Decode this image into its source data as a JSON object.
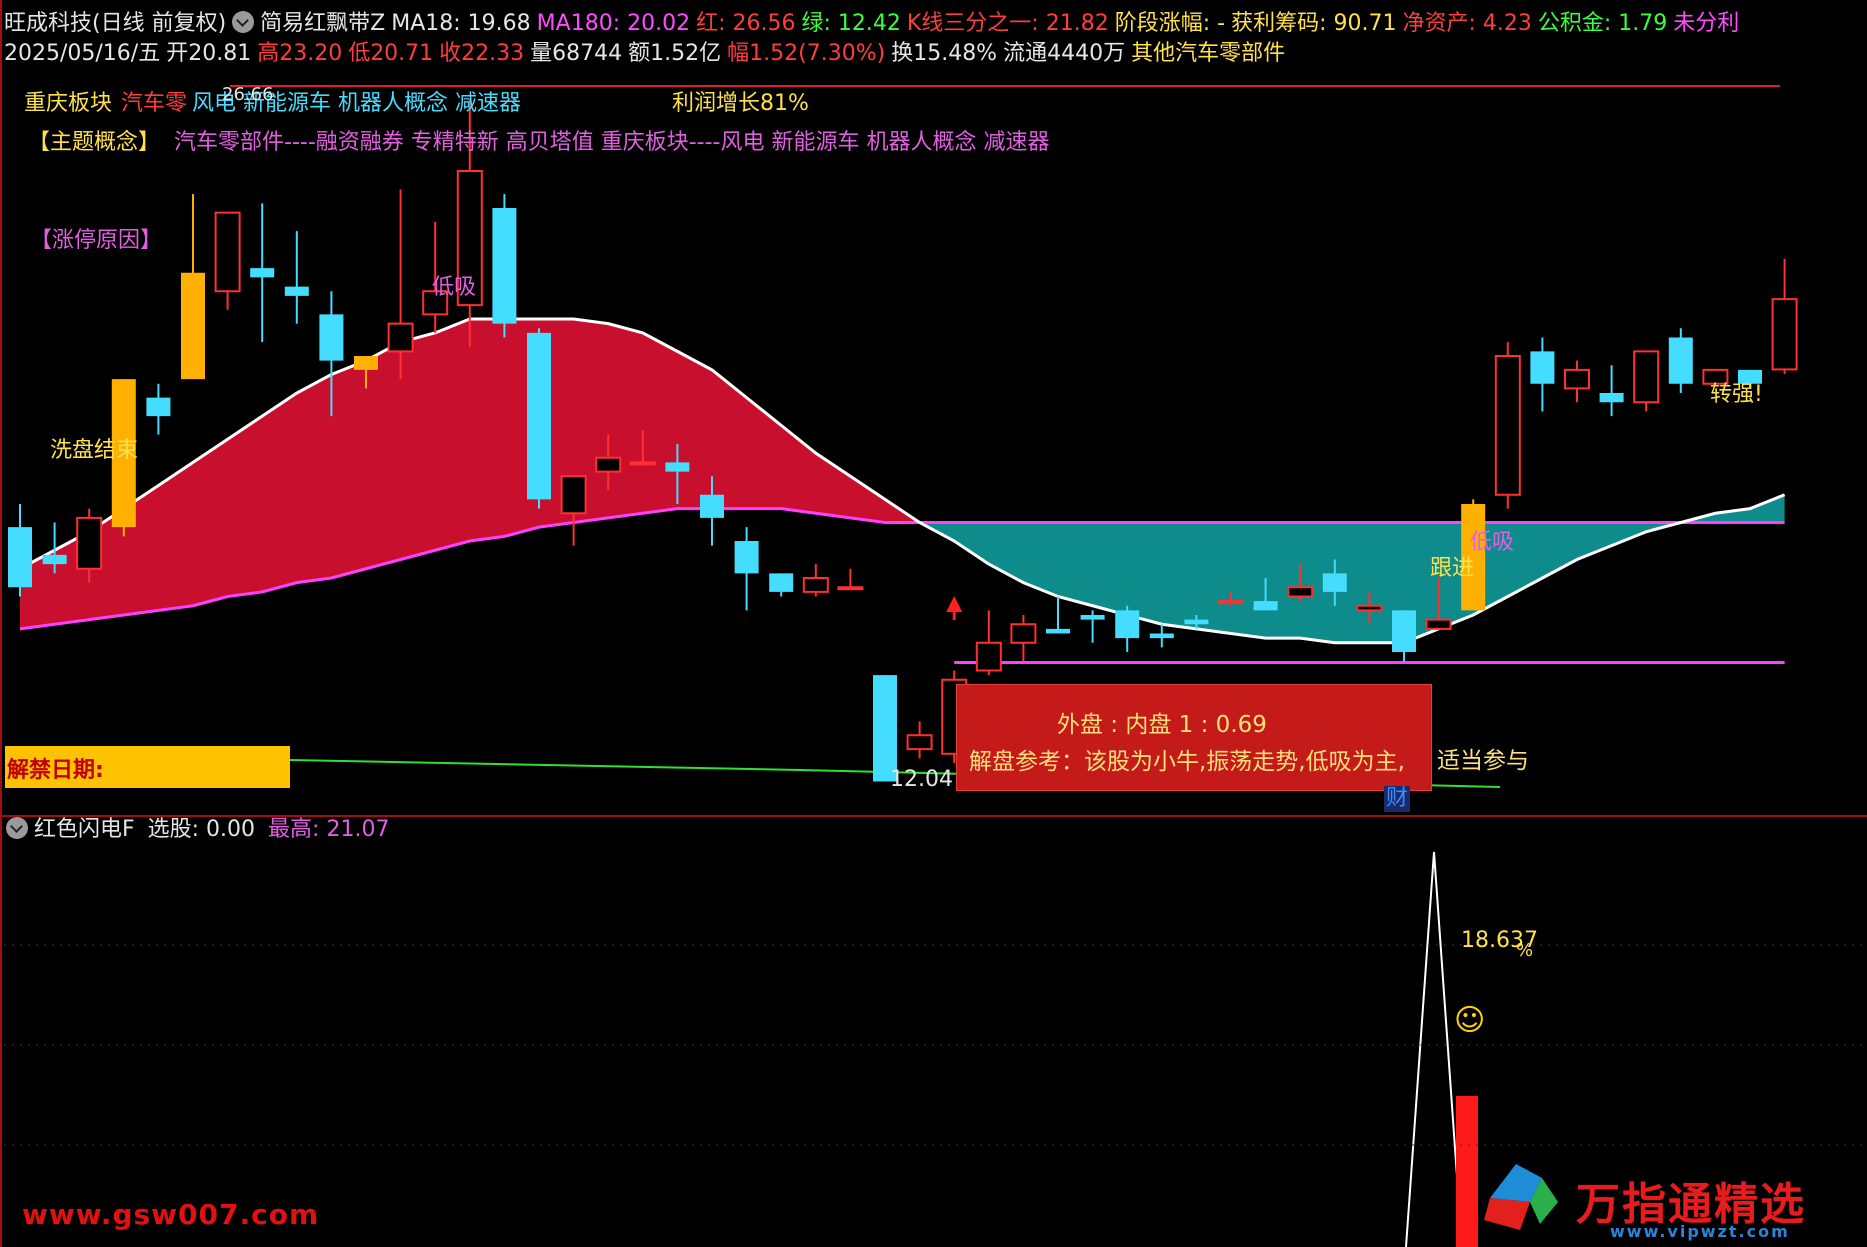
{
  "header": {
    "line1": [
      {
        "text": "旺成科技(日线 前复权)",
        "color": "#e6e6e6"
      },
      {
        "text": "",
        "color": "#9a9a9a",
        "icon": "settings-circle-icon"
      },
      {
        "text": "简易红飘带Z",
        "color": "#e6e6e6"
      },
      {
        "text": "MA18: 19.68",
        "color": "#e6e6e6"
      },
      {
        "text": "MA180: 20.02",
        "color": "#ff4bff"
      },
      {
        "text": "红: 26.56",
        "color": "#ff3d3d"
      },
      {
        "text": "绿: 12.42",
        "color": "#3cff3c"
      },
      {
        "text": "K线三分之一: 21.82",
        "color": "#ff3d3d"
      },
      {
        "text": "阶段涨幅: -",
        "color": "#ffe14a"
      },
      {
        "text": "获利筹码: 90.71",
        "color": "#ffe14a"
      },
      {
        "text": "净资产: 4.23",
        "color": "#ff3d3d"
      },
      {
        "text": "公积金: 1.79",
        "color": "#3cff3c"
      },
      {
        "text": "未分利",
        "color": "#ff4bff"
      }
    ],
    "line2": [
      {
        "text": "2025/05/16/五",
        "color": "#e6e6e6"
      },
      {
        "text": "开20.81",
        "color": "#e6e6e6"
      },
      {
        "text": "高23.20",
        "color": "#ff3d3d"
      },
      {
        "text": "低20.71",
        "color": "#ff3d3d"
      },
      {
        "text": "收22.33",
        "color": "#ff3d3d"
      },
      {
        "text": "量68744",
        "color": "#e6e6e6"
      },
      {
        "text": "额1.52亿",
        "color": "#e6e6e6"
      },
      {
        "text": "幅1.52(7.30%)",
        "color": "#ff3d3d"
      },
      {
        "text": "换15.48%",
        "color": "#e6e6e6"
      },
      {
        "text": "流通4440万",
        "color": "#e6e6e6"
      },
      {
        "text": "其他汽车零部件",
        "color": "#ffe14a"
      }
    ]
  },
  "tags": {
    "sector_a": "重庆板块",
    "sector_b": "汽车零",
    "sector_c": "风电 新能源车 机器人概念 减速器",
    "profit": "利润增长81%",
    "theme_label": "【主题概念】",
    "theme_text": "汽车零部件----融资融券 专精特新 高贝塔值 重庆板块----风电 新能源车 机器人概念 减速器",
    "limit_reason": "【涨停原因】",
    "high_price": "26.66",
    "low_price": "12.04"
  },
  "signals": {
    "wash_end": "洗盘结束",
    "low_buy": "低吸",
    "follow": "跟进",
    "dip_buy": "低吸",
    "turn_strong": "转强!",
    "wealth": "财"
  },
  "release": {
    "label": "解禁日期:"
  },
  "popup": {
    "line1": "外盘 : 内盘   1  :  0.69",
    "line2": "解盘参考：该股为小牛,振荡走势,低吸为主,",
    "tail": "适当参与"
  },
  "indicator": {
    "name": "红色闪电F",
    "select_label": "选股: 0.00",
    "max_label": "最高:",
    "max_value": "21.07",
    "peak_label": "18.637",
    "pct": "%"
  },
  "watermarks": {
    "left": "www.gsw007.com",
    "right": "万指通精选",
    "url": "www.vipwzt.com"
  },
  "colors": {
    "up": "#ff3030",
    "down": "#44ddff",
    "limit_up": "#ffb000",
    "ma_short": "#ffffff",
    "ma_long": "#ff40ff",
    "ribbon_red": "#c8102e",
    "ribbon_teal": "#0e8c8c",
    "panel_border": "#a01010"
  },
  "chart_data": {
    "type": "candlestick",
    "price_range": [
      11.5,
      27.5
    ],
    "candles": [
      {
        "o": 17.4,
        "h": 17.9,
        "l": 15.9,
        "c": 16.1
      },
      {
        "o": 16.8,
        "h": 17.5,
        "l": 16.4,
        "c": 16.6
      },
      {
        "o": 16.5,
        "h": 17.8,
        "l": 16.2,
        "c": 17.6
      },
      {
        "o": 17.4,
        "h": 20.6,
        "l": 17.2,
        "c": 20.6,
        "limit": true
      },
      {
        "o": 20.2,
        "h": 20.5,
        "l": 19.4,
        "c": 19.8
      },
      {
        "o": 20.6,
        "h": 24.6,
        "l": 20.6,
        "c": 22.9,
        "limit": true
      },
      {
        "o": 22.5,
        "h": 23.6,
        "l": 22.1,
        "c": 24.2
      },
      {
        "o": 23.0,
        "h": 24.4,
        "l": 21.4,
        "c": 22.8
      },
      {
        "o": 22.6,
        "h": 23.8,
        "l": 21.8,
        "c": 22.4
      },
      {
        "o": 22.0,
        "h": 22.5,
        "l": 19.8,
        "c": 21.0
      },
      {
        "o": 20.8,
        "h": 20.8,
        "l": 20.4,
        "c": 21.1,
        "limit": true
      },
      {
        "o": 21.2,
        "h": 24.7,
        "l": 20.6,
        "c": 21.8
      },
      {
        "o": 22.0,
        "h": 24.0,
        "l": 21.6,
        "c": 22.5
      },
      {
        "o": 22.2,
        "h": 26.66,
        "l": 21.3,
        "c": 25.1
      },
      {
        "o": 24.3,
        "h": 24.6,
        "l": 21.5,
        "c": 21.8
      },
      {
        "o": 21.6,
        "h": 21.7,
        "l": 17.8,
        "c": 18.0
      },
      {
        "o": 17.7,
        "h": 18.4,
        "l": 17.0,
        "c": 18.5
      },
      {
        "o": 18.6,
        "h": 19.4,
        "l": 18.2,
        "c": 18.9
      },
      {
        "o": 18.8,
        "h": 19.5,
        "l": 18.8,
        "c": 18.8
      },
      {
        "o": 18.8,
        "h": 19.2,
        "l": 17.9,
        "c": 18.6
      },
      {
        "o": 18.1,
        "h": 18.5,
        "l": 17.0,
        "c": 17.6
      },
      {
        "o": 17.1,
        "h": 17.4,
        "l": 15.6,
        "c": 16.4
      },
      {
        "o": 16.4,
        "h": 16.4,
        "l": 15.9,
        "c": 16.0
      },
      {
        "o": 16.0,
        "h": 16.6,
        "l": 15.9,
        "c": 16.3
      },
      {
        "o": 16.1,
        "h": 16.5,
        "l": 16.1,
        "c": 16.1
      },
      {
        "o": 14.2,
        "h": 14.2,
        "l": 12.04,
        "c": 11.9
      },
      {
        "o": 12.6,
        "h": 13.2,
        "l": 12.4,
        "c": 12.9
      },
      {
        "o": 12.5,
        "h": 14.3,
        "l": 12.3,
        "c": 14.1
      },
      {
        "o": 14.3,
        "h": 15.6,
        "l": 14.2,
        "c": 14.9
      },
      {
        "o": 14.9,
        "h": 15.5,
        "l": 14.5,
        "c": 15.3
      },
      {
        "o": 15.2,
        "h": 15.9,
        "l": 15.1,
        "c": 15.1
      },
      {
        "o": 15.5,
        "h": 15.6,
        "l": 14.9,
        "c": 15.4
      },
      {
        "o": 15.6,
        "h": 15.7,
        "l": 14.7,
        "c": 15.0
      },
      {
        "o": 15.1,
        "h": 15.3,
        "l": 14.8,
        "c": 15.0
      },
      {
        "o": 15.4,
        "h": 15.5,
        "l": 15.2,
        "c": 15.3
      },
      {
        "o": 15.8,
        "h": 16.0,
        "l": 15.7,
        "c": 15.8
      },
      {
        "o": 15.8,
        "h": 16.3,
        "l": 15.7,
        "c": 15.6
      },
      {
        "o": 15.9,
        "h": 16.6,
        "l": 15.8,
        "c": 16.1
      },
      {
        "o": 16.4,
        "h": 16.7,
        "l": 15.7,
        "c": 16.0
      },
      {
        "o": 15.6,
        "h": 16.0,
        "l": 15.3,
        "c": 15.7
      },
      {
        "o": 15.6,
        "h": 15.6,
        "l": 14.5,
        "c": 14.7
      },
      {
        "o": 15.2,
        "h": 16.3,
        "l": 15.2,
        "c": 15.4
      },
      {
        "o": 15.6,
        "h": 18.0,
        "l": 15.6,
        "c": 17.9,
        "limit": true
      },
      {
        "o": 18.1,
        "h": 21.4,
        "l": 17.8,
        "c": 21.1
      },
      {
        "o": 21.2,
        "h": 21.5,
        "l": 19.9,
        "c": 20.5
      },
      {
        "o": 20.4,
        "h": 21.0,
        "l": 20.1,
        "c": 20.8
      },
      {
        "o": 20.3,
        "h": 20.9,
        "l": 19.8,
        "c": 20.1
      },
      {
        "o": 20.1,
        "h": 21.2,
        "l": 19.9,
        "c": 21.2
      },
      {
        "o": 21.5,
        "h": 21.7,
        "l": 20.3,
        "c": 20.5
      },
      {
        "o": 20.5,
        "h": 20.8,
        "l": 20.5,
        "c": 20.8
      },
      {
        "o": 20.8,
        "h": 20.8,
        "l": 20.4,
        "c": 20.5
      },
      {
        "o": 20.81,
        "h": 23.2,
        "l": 20.71,
        "c": 22.33
      }
    ],
    "ma_short": [
      16.5,
      16.9,
      17.3,
      17.8,
      18.3,
      18.8,
      19.3,
      19.8,
      20.3,
      20.7,
      21.0,
      21.4,
      21.6,
      21.9,
      21.9,
      21.9,
      21.9,
      21.8,
      21.6,
      21.2,
      20.8,
      20.2,
      19.6,
      19.0,
      18.5,
      18.0,
      17.5,
      17.1,
      16.6,
      16.2,
      15.9,
      15.7,
      15.5,
      15.3,
      15.2,
      15.1,
      15.0,
      15.0,
      14.9,
      14.9,
      14.9,
      15.2,
      15.5,
      15.9,
      16.3,
      16.7,
      17.0,
      17.3,
      17.5,
      17.7,
      17.8,
      18.1
    ],
    "ma_long": [
      15.2,
      15.3,
      15.4,
      15.5,
      15.6,
      15.7,
      15.9,
      16.0,
      16.2,
      16.3,
      16.5,
      16.7,
      16.9,
      17.1,
      17.2,
      17.4,
      17.5,
      17.6,
      17.7,
      17.8,
      17.8,
      17.8,
      17.8,
      17.7,
      17.6,
      17.5,
      17.5,
      17.5,
      17.5,
      17.5,
      17.5,
      17.5,
      17.5,
      17.5,
      17.5,
      17.5,
      17.5,
      17.5,
      17.5,
      17.5,
      17.5,
      17.5,
      17.5,
      17.5,
      17.5,
      17.5,
      17.5,
      17.5,
      17.5,
      17.5,
      17.5,
      17.5
    ],
    "support_line": 11.9,
    "indicator_peak": 18.637,
    "indicator_max": 21.07
  }
}
